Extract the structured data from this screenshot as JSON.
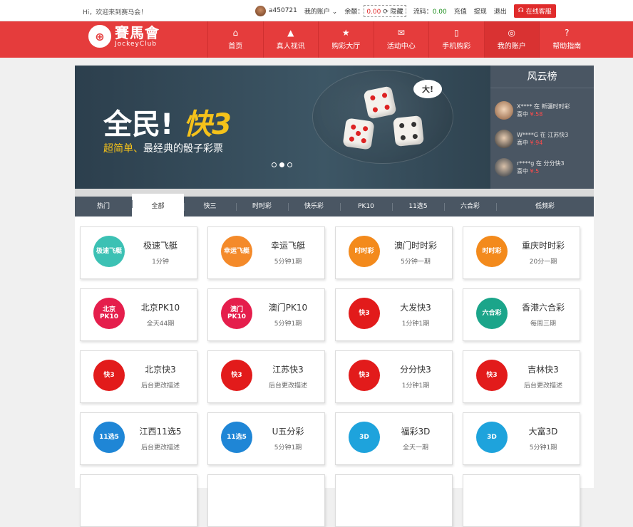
{
  "topbar": {
    "welcome": "Hi，欢迎来到赛马会！",
    "username": "a450721",
    "account_menu": "我的账户",
    "balance_label": "余额：",
    "balance_value": "0.00",
    "hide_label": "隐藏",
    "rebate_label": "流码：",
    "rebate_value": "0.00",
    "recharge": "充值",
    "withdraw": "提现",
    "logout": "退出",
    "service": "在线客服"
  },
  "logo": {
    "cn": "賽馬會",
    "en": "JockeyClub"
  },
  "nav": [
    {
      "label": "首页",
      "icon": "home-icon",
      "glyph": "⌂"
    },
    {
      "label": "真人视讯",
      "icon": "triangle-icon",
      "glyph": "▲"
    },
    {
      "label": "购彩大厅",
      "icon": "star-icon",
      "glyph": "★"
    },
    {
      "label": "活动中心",
      "icon": "gift-icon",
      "glyph": "✉"
    },
    {
      "label": "手机购彩",
      "icon": "mobile-icon",
      "glyph": "▯"
    },
    {
      "label": "我的账户",
      "icon": "user-icon",
      "glyph": "◎"
    },
    {
      "label": "帮助指南",
      "icon": "help-icon",
      "glyph": "?"
    }
  ],
  "banner": {
    "title_a": "全民!",
    "title_b": "快3",
    "subtitle_a": "超简单、",
    "subtitle_b": "最经典的骰子彩票",
    "bubble": "大!",
    "slides": 3,
    "active_slide": 2
  },
  "leaderboard": {
    "title": "风云榜",
    "rows": [
      {
        "line1": "X**** 在 新疆时时彩",
        "won": "喜中",
        "amount": "¥.58"
      },
      {
        "line1": "W****G 在 江苏快3",
        "won": "喜中",
        "amount": "¥.94"
      },
      {
        "line1": "r****g 在 分分快3",
        "won": "喜中",
        "amount": "¥.5"
      }
    ]
  },
  "tabs": [
    "热门",
    "全部",
    "快三",
    "时时彩",
    "快乐彩",
    "PK10",
    "11选5",
    "六合彩",
    "低频彩"
  ],
  "active_tab": 1,
  "games": [
    {
      "name": "极速飞艇",
      "sub": "1分钟",
      "color": "#3cc1b4",
      "icon_text": "极速飞艇"
    },
    {
      "name": "幸运飞艇",
      "sub": "5分钟1期",
      "color": "#f48a2a",
      "icon_text": "幸运飞艇"
    },
    {
      "name": "澳门时时彩",
      "sub": "5分钟一期",
      "color": "#f38a1c",
      "icon_text": "时时彩"
    },
    {
      "name": "重庆时时彩",
      "sub": "20分一期",
      "color": "#f38a1c",
      "icon_text": "时时彩"
    },
    {
      "name": "北京PK10",
      "sub": "全天44期",
      "color": "#e51e4c",
      "icon_text": "北京 PK10"
    },
    {
      "name": "澳门PK10",
      "sub": "5分钟1期",
      "color": "#e51e4c",
      "icon_text": "澳门 PK10"
    },
    {
      "name": "大发快3",
      "sub": "1分钟1期",
      "color": "#e21b1b",
      "icon_text": "快3"
    },
    {
      "name": "香港六合彩",
      "sub": "每周三期",
      "color": "#1ba58a",
      "icon_text": "六合彩"
    },
    {
      "name": "北京快3",
      "sub": "后台更改描述",
      "color": "#e21b1b",
      "icon_text": "快3"
    },
    {
      "name": "江苏快3",
      "sub": "后台更改描述",
      "color": "#e21b1b",
      "icon_text": "快3"
    },
    {
      "name": "分分快3",
      "sub": "1分钟1期",
      "color": "#e21b1b",
      "icon_text": "快3"
    },
    {
      "name": "吉林快3",
      "sub": "后台更改描述",
      "color": "#e21b1b",
      "icon_text": "快3"
    },
    {
      "name": "江西11选5",
      "sub": "后台更改描述",
      "color": "#1f86d6",
      "icon_text": "11选5"
    },
    {
      "name": "U五分彩",
      "sub": "5分钟1期",
      "color": "#1f86d6",
      "icon_text": "11选5"
    },
    {
      "name": "福彩3D",
      "sub": "全天一期",
      "color": "#1ea3dc",
      "icon_text": "3D"
    },
    {
      "name": "大富3D",
      "sub": "5分钟1期",
      "color": "#1ea3dc",
      "icon_text": "3D"
    }
  ]
}
